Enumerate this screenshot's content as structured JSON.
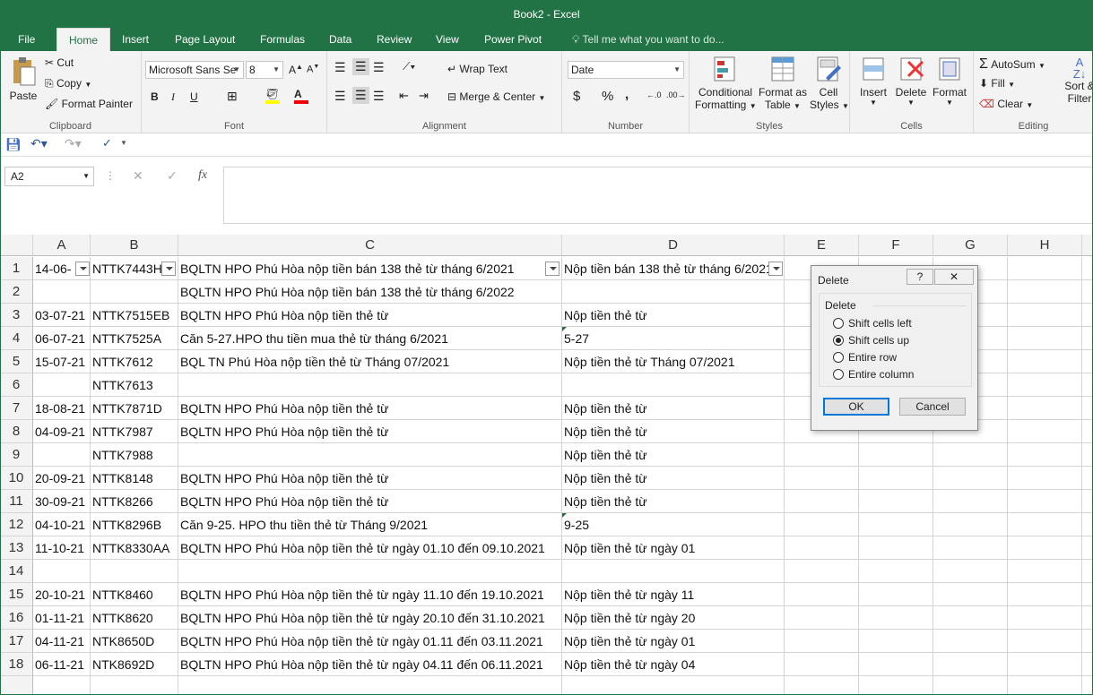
{
  "window": {
    "title": "Book2 - Excel"
  },
  "tabs": [
    "File",
    "Home",
    "Insert",
    "Page Layout",
    "Formulas",
    "Data",
    "Review",
    "View",
    "Power Pivot"
  ],
  "tell_me": "Tell me what you want to do...",
  "ribbon": {
    "clipboard": {
      "paste": "Paste",
      "cut": "Cut",
      "copy": "Copy",
      "format_painter": "Format Painter",
      "label": "Clipboard"
    },
    "font": {
      "name": "Microsoft Sans Se",
      "size": "8",
      "bold": "B",
      "italic": "I",
      "underline": "U",
      "label": "Font"
    },
    "alignment": {
      "wrap": "Wrap Text",
      "merge": "Merge & Center",
      "label": "Alignment"
    },
    "number": {
      "format": "Date",
      "dollar": "$",
      "percent": "%",
      "comma": ",",
      "label": "Number"
    },
    "styles": {
      "cond1": "Conditional",
      "cond2": "Formatting",
      "fmt1": "Format as",
      "fmt2": "Table",
      "cell1": "Cell",
      "cell2": "Styles",
      "label": "Styles"
    },
    "cells": {
      "insert": "Insert",
      "delete": "Delete",
      "format": "Format",
      "label": "Cells"
    },
    "editing": {
      "autosum": "AutoSum",
      "fill": "Fill",
      "clear": "Clear",
      "sort1": "Sort &",
      "sort2": "Filter",
      "label": "Editing"
    }
  },
  "formula_bar": {
    "name_box": "A2",
    "value": ""
  },
  "columns": [
    "A",
    "B",
    "C",
    "D",
    "E",
    "F",
    "G",
    "H"
  ],
  "rows": [
    [
      "14-06-",
      "NTTK7443H",
      "BQLTN HPO Phú Hòa nộp tiền bán 138 thẻ từ tháng 6/2021",
      "Nộp tiền bán 138 thẻ từ tháng 6/2021"
    ],
    [
      "",
      "",
      "BQLTN HPO Phú Hòa nộp tiền bán 138 thẻ từ tháng 6/2022",
      ""
    ],
    [
      "03-07-21",
      "NTTK7515EB",
      "BQLTN HPO Phú Hòa nộp tiền thẻ từ",
      "Nộp tiền thẻ từ"
    ],
    [
      "06-07-21",
      "NTTK7525A",
      "Căn 5-27.HPO thu tiền mua thẻ từ  tháng 6/2021",
      "5-27"
    ],
    [
      "15-07-21",
      "NTTK7612",
      "BQL TN Phú Hòa nộp tiền thẻ từ Tháng 07/2021",
      "Nộp tiền thẻ từ Tháng 07/2021"
    ],
    [
      "",
      "NTTK7613",
      "",
      ""
    ],
    [
      "18-08-21",
      "NTTK7871D",
      "BQLTN HPO Phú Hòa nộp tiền thẻ từ",
      "Nộp tiền thẻ từ"
    ],
    [
      "04-09-21",
      "NTTK7987",
      "BQLTN HPO Phú Hòa nộp tiền thẻ từ",
      "Nộp tiền thẻ từ"
    ],
    [
      "",
      "NTTK7988",
      "",
      "Nộp tiền thẻ từ"
    ],
    [
      "20-09-21",
      "NTTK8148",
      "BQLTN HPO Phú Hòa nộp tiền thẻ từ",
      "Nộp tiền thẻ từ"
    ],
    [
      "30-09-21",
      "NTTK8266",
      "BQLTN HPO Phú Hòa nộp tiền thẻ từ",
      "Nộp tiền thẻ từ"
    ],
    [
      "04-10-21",
      "NTTK8296B",
      "Căn 9-25. HPO thu tiền thẻ từ Tháng 9/2021",
      "9-25"
    ],
    [
      "11-10-21",
      "NTTK8330AA",
      "BQLTN HPO Phú Hòa nộp tiền thẻ từ ngày 01.10 đến 09.10.2021",
      "Nộp tiền thẻ từ ngày 01"
    ],
    [
      "",
      "",
      "",
      ""
    ],
    [
      "20-10-21",
      "NTTK8460",
      "BQLTN HPO Phú Hòa nộp tiền thẻ từ ngày 11.10 đến 19.10.2021",
      "Nộp tiền thẻ từ ngày 11"
    ],
    [
      "01-11-21",
      "NTTK8620",
      "BQLTN HPO Phú Hòa nộp tiền thẻ từ ngày 20.10 đến 31.10.2021",
      "Nộp tiền thẻ từ ngày 20"
    ],
    [
      "04-11-21",
      "NTK8650D",
      "BQLTN HPO Phú Hòa nộp tiền thẻ từ ngày 01.11 đến 03.11.2021",
      "Nộp tiền thẻ từ ngày 01"
    ],
    [
      "06-11-21",
      "NTK8692D",
      "BQLTN HPO Phú Hòa nộp tiền thẻ từ ngày 04.11 đến 06.11.2021",
      "Nộp tiền thẻ từ ngày 04"
    ]
  ],
  "dialog": {
    "title": "Delete",
    "help": "?",
    "group": "Delete",
    "options": [
      "Shift cells left",
      "Shift cells up",
      "Entire row",
      "Entire column"
    ],
    "selected": "Shift cells up",
    "ok": "OK",
    "cancel": "Cancel"
  }
}
